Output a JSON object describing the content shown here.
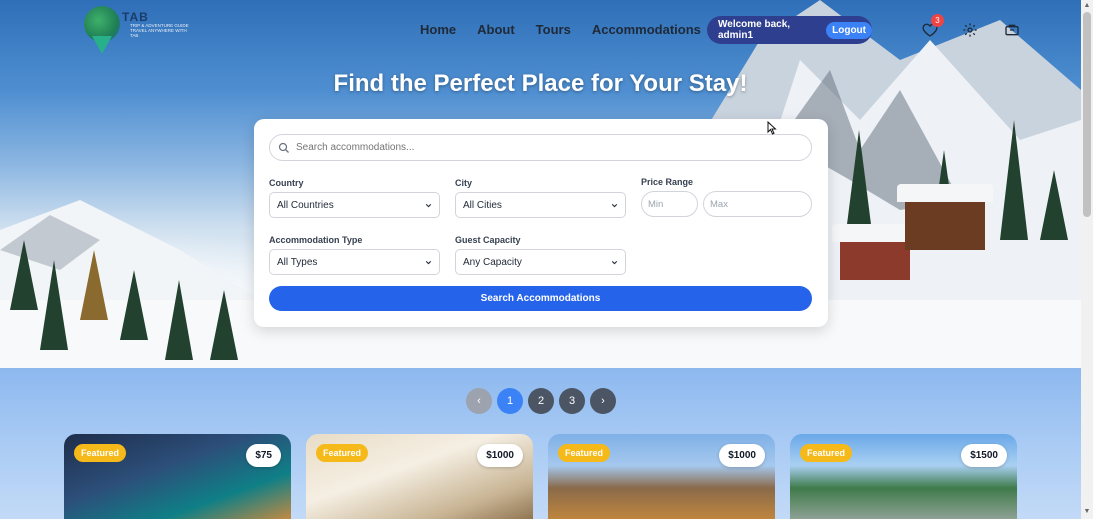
{
  "brand": {
    "logo_text": "TAB",
    "logo_sub": "TRIP & ADVENTURE GUIDE TRAVEL ANYWHERE WITH TAB"
  },
  "nav": {
    "home": "Home",
    "about": "About",
    "tours": "Tours",
    "accommodations": "Accommodations"
  },
  "user": {
    "welcome": "Welcome back, admin1",
    "logout": "Logout"
  },
  "icons": {
    "wishlist": "heart-icon",
    "wishlist_count": "3",
    "settings": "gear-icon",
    "bookings": "ticket-icon"
  },
  "hero": {
    "title": "Find the Perfect Place for Your Stay!"
  },
  "search": {
    "placeholder": "Search accommodations...",
    "country_label": "Country",
    "country_value": "All Countries",
    "city_label": "City",
    "city_value": "All Cities",
    "price_label": "Price Range",
    "price_min": "Min",
    "price_max": "Max",
    "type_label": "Accommodation Type",
    "type_value": "All Types",
    "capacity_label": "Guest Capacity",
    "capacity_value": "Any Capacity",
    "button": "Search Accommodations"
  },
  "pagination": {
    "prev": "‹",
    "pages": [
      "1",
      "2",
      "3"
    ],
    "next": "›",
    "active": 1
  },
  "cards": [
    {
      "badge": "Featured",
      "price": "$75"
    },
    {
      "badge": "Featured",
      "price": "$1000"
    },
    {
      "badge": "Featured",
      "price": "$1000"
    },
    {
      "badge": "Featured",
      "price": "$1500"
    }
  ],
  "colors": {
    "primary": "#2563eb",
    "welcome_bg": "#2f3f8f",
    "featured": "#f5b919",
    "badge": "#ef4444"
  }
}
